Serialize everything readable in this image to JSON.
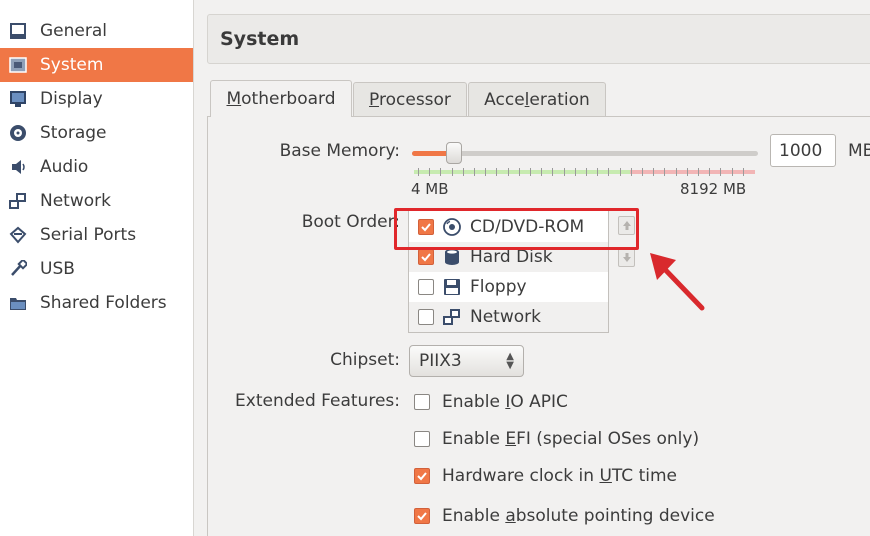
{
  "sidebar": {
    "items": [
      {
        "label": "General",
        "icon": "general-icon"
      },
      {
        "label": "System",
        "icon": "system-icon",
        "selected": true
      },
      {
        "label": "Display",
        "icon": "display-icon"
      },
      {
        "label": "Storage",
        "icon": "storage-icon"
      },
      {
        "label": "Audio",
        "icon": "audio-icon"
      },
      {
        "label": "Network",
        "icon": "network-icon"
      },
      {
        "label": "Serial Ports",
        "icon": "serial-ports-icon"
      },
      {
        "label": "USB",
        "icon": "usb-icon"
      },
      {
        "label": "Shared Folders",
        "icon": "shared-folders-icon"
      }
    ]
  },
  "header": {
    "title": "System"
  },
  "tabs": [
    {
      "pre": "",
      "mn": "M",
      "post": "otherboard",
      "active": true
    },
    {
      "pre": "",
      "mn": "P",
      "post": "rocessor",
      "active": false
    },
    {
      "pre": "Acce",
      "mn": "l",
      "post": "eration",
      "active": false
    }
  ],
  "memory": {
    "label": "Base Memory:",
    "value": "1000",
    "unit": "MB",
    "min_label": "4 MB",
    "max_label": "8192 MB",
    "slider_fraction": 0.12
  },
  "boot": {
    "label": "Boot Order:",
    "items": [
      {
        "label": "CD/DVD-ROM",
        "checked": true,
        "icon": "cd-dvd-icon"
      },
      {
        "label": "Hard Disk",
        "checked": true,
        "icon": "hard-disk-icon"
      },
      {
        "label": "Floppy",
        "checked": false,
        "icon": "floppy-icon"
      },
      {
        "label": "Network",
        "checked": false,
        "icon": "network-icon"
      }
    ]
  },
  "chipset": {
    "label": "Chipset:",
    "value": "PIIX3"
  },
  "features": {
    "label": "Extended Features:",
    "items": [
      {
        "pre": "Enable ",
        "mn": "I",
        "post": "O APIC",
        "checked": false
      },
      {
        "pre": "Enable ",
        "mn": "E",
        "post": "FI (special OSes only)",
        "checked": false
      },
      {
        "pre": "Hardware clock in ",
        "mn": "U",
        "post": "TC time",
        "checked": true
      },
      {
        "pre": "Enable ",
        "mn": "a",
        "post": "bsolute pointing device",
        "checked": true
      }
    ]
  },
  "colors": {
    "accent": "#f07746",
    "highlight": "#e0272b"
  }
}
